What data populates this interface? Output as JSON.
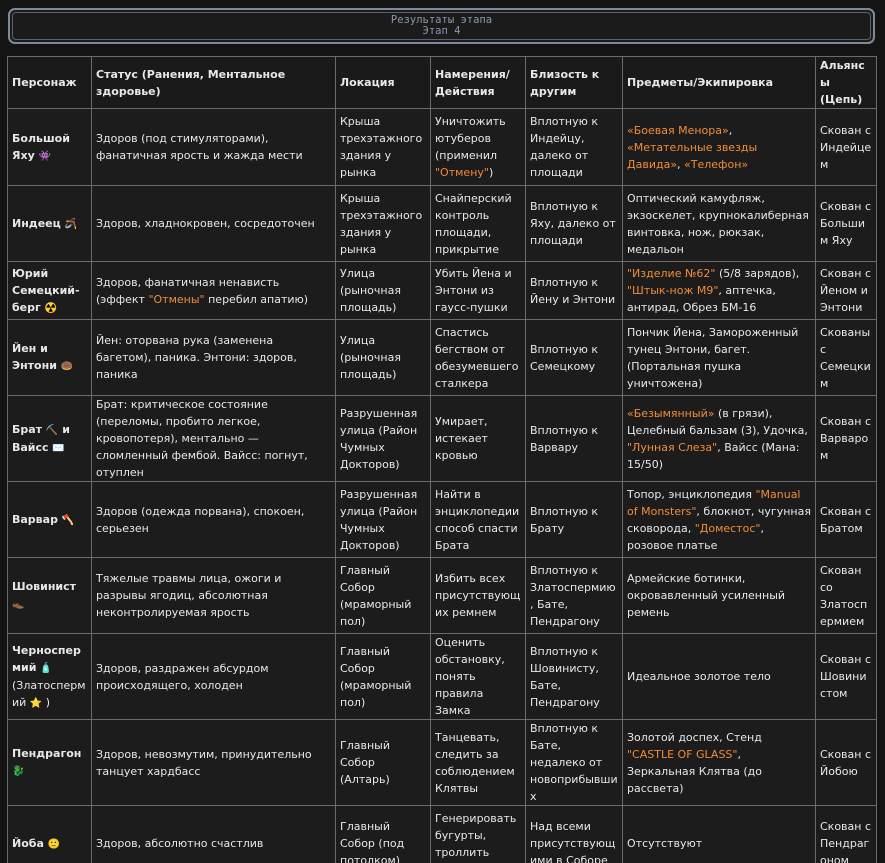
{
  "header": {
    "title": "Результаты этапа",
    "subtitle": "Этап 4"
  },
  "colors": {
    "highlight": "#f28c38",
    "text": "#e8e8e8",
    "background": "#141414",
    "border": "#6b6b6b"
  },
  "table": {
    "columns": [
      "Персонаж",
      "Статус (Ранения, Ментальное здоровье)",
      "Локация",
      "Намерения/ Действия",
      "Близость к другим",
      "Предметы/Экипировка",
      "Альянсы (Цепь)"
    ],
    "rows": [
      {
        "character": "Большой Яху",
        "emoji": "👾",
        "status": "Здоров (под стимуляторами), фанатичная ярость и жажда мести",
        "location": "Крыша трехэтажного здания у рынка",
        "intent_a": "Уничтожить ютуберов (применил ",
        "intent_hl": "\"Отмену\"",
        "intent_b": ")",
        "proximity": "Вплотную к Индейцу, далеко от площади",
        "items_1": "«Боевая Менора»",
        "items_sep1": ", ",
        "items_2": "«Метательные звезды Давида»",
        "items_sep2": ", ",
        "items_3": "«Телефон»",
        "alliance": "Скован с Индейцем"
      },
      {
        "character": "Индеец",
        "emoji": "🪃",
        "status": "Здоров, хладнокровен, сосредоточен",
        "location": "Крыша трехэтажного здания у рынка",
        "intent": "Снайперский контроль площади, прикрытие",
        "proximity": "Вплотную к Яху, далеко от площади",
        "items": "Оптический камуфляж, экзоскелет, крупнокалиберная винтовка, нож, рюкзак, медальон",
        "alliance": "Скован с Большим Яху"
      },
      {
        "character": "Юрий Семецкий-берг",
        "emoji": "☢️",
        "status_a": "Здоров, фанатичная ненависть (эффект ",
        "status_hl": "\"Отмены\"",
        "status_b": " перебил апатию)",
        "location": "Улица (рыночная площадь)",
        "intent": "Убить Йена и Энтони из гаусс-пушки",
        "proximity": "Вплотную к Йену и Энтони",
        "items_1": "\"Изделие №62\"",
        "items_a": " (5/8 зарядов), ",
        "items_2": "\"Штык-нож М9\"",
        "items_b": ", аптечка, антирад, Обрез БМ-16",
        "alliance": "Скован с Йеном и Энтони"
      },
      {
        "character": "Йен и Энтони",
        "emoji": "🍩",
        "status": "Йен: оторвана рука (заменена багетом), паника. Энтони: здоров, паника",
        "location": "Улица (рыночная площадь)",
        "intent": "Спастись бегством от обезумевшего сталкера",
        "proximity": "Вплотную к Семецкому",
        "items": "Пончик Йена, Замороженный тунец Энтони, багет. (Портальная пушка уничтожена)",
        "alliance": "Скованы с Семецким"
      },
      {
        "character_a": "Брат",
        "emoji_a": "⛏️",
        "character_mid": " и Вайсс",
        "emoji_b": "✉️",
        "status": "Брат: критическое состояние (переломы, пробито легкое, кровопотеря), ментально — сломленный фембой. Вайсс: погнут, отуплен",
        "location": "Разрушенная улица (Район Чумных Докторов)",
        "intent": "Умирает, истекает кровью",
        "proximity": "Вплотную к Варвару",
        "items_1": "«Безымянный»",
        "items_a": " (в грязи), Целебный бальзам (3), Удочка, ",
        "items_2": "\"Лунная Слеза\"",
        "items_b": ", Вайсс (Мана: 15/50)",
        "alliance": "Скован с Варваром"
      },
      {
        "character": "Варвар",
        "emoji": "🪓",
        "status": "Здоров (одежда порвана), спокоен, серьезен",
        "location": "Разрушенная улица (Район Чумных Докторов)",
        "intent": "Найти в энциклопедии способ спасти Брата",
        "proximity": "Вплотную к Брату",
        "items_a": "Топор, энциклопедия ",
        "items_1": "\"Manual of Monsters\"",
        "items_b": ", блокнот, чугунная сковорода, ",
        "items_2": "\"Доместос\"",
        "items_c": ", розовое платье",
        "alliance": "Скован с Братом"
      },
      {
        "character": "Шовинист",
        "emoji": "👞",
        "status": "Тяжелые травмы лица, ожоги и разрывы ягодиц, абсолютная неконтролируемая ярость",
        "location": "Главный Собор (мраморный пол)",
        "intent": "Избить всех присутствующих ремнем",
        "proximity": "Вплотную к Златоспермию, Бате, Пендрагону",
        "items": "Армейские ботинки, окровавленный усиленный ремень",
        "alliance": "Скован со Златоспермием"
      },
      {
        "character": "Черноспермий",
        "emoji": "🧴",
        "alias": "(Златоспермий",
        "emoji_b": "⭐",
        "alias_end": ")",
        "status": "Здоров, раздражен абсурдом происходящего, холоден",
        "location": "Главный Собор (мраморный пол)",
        "intent": "Оценить обстановку, понять правила Замка",
        "proximity": "Вплотную к Шовинисту, Бате, Пендрагону",
        "items": "Идеальное золотое тело",
        "alliance": "Скован с Шовинистом"
      },
      {
        "character": "Пендрагон",
        "emoji": "🐉",
        "status": "Здоров, невозмутим, принудительно танцует хардбасс",
        "location": "Главный Собор (Алтарь)",
        "intent": "Танцевать, следить за соблюдением Клятвы",
        "proximity": "Вплотную к Бате, недалеко от новоприбывших",
        "items_a": "Золотой доспех, Стенд ",
        "items_1": "\"CASTLE OF GLASS\"",
        "items_b": ", Зеркальная Клятва (до рассвета)",
        "alliance": "Скован с Йобою"
      },
      {
        "character": "Йоба",
        "emoji": "🙂",
        "status": "Здоров, абсолютно счастлив",
        "location": "Главный Собор (под потолком)",
        "intent": "Генерировать бугурты, троллить Шовиниста",
        "proximity": "Над всеми присутствующими в Соборе",
        "items": "Отсутствуют",
        "alliance": "Скован с Пендрагоном"
      }
    ]
  }
}
